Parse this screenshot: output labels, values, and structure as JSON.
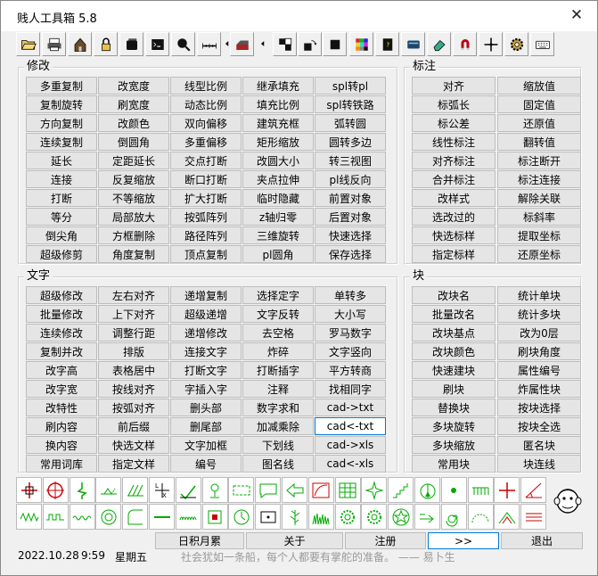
{
  "app": {
    "title": "贱人工具箱 5.8",
    "close_glyph": "✕"
  },
  "toolbar_icons": [
    "open-folder-icon",
    "print-icon",
    "house-icon",
    "lock-icon",
    "stack-icon",
    "terminal-icon",
    "magnifier-icon",
    "measure-icon",
    "arrow-left-icon",
    "wall-icon",
    "arrow-left-icon",
    "blocks-icon",
    "copy-rotate-icon",
    "black-square-icon",
    "color-grid-icon",
    "notebook-icon",
    "card-icon",
    "eraser-icon",
    "magnet-icon",
    "crosshair-icon",
    "gear-icon",
    "keyboard-icon"
  ],
  "groups": {
    "modify": {
      "label": "修改",
      "rows": [
        [
          "多重复制",
          "改宽度",
          "线型比例",
          "继承填充",
          "spl转pl"
        ],
        [
          "复制旋转",
          "刷宽度",
          "动态比例",
          "填充比例",
          "spl转铁路"
        ],
        [
          "方向复制",
          "改颜色",
          "双向偏移",
          "建筑充框",
          "弧转圆"
        ],
        [
          "连续复制",
          "倒圆角",
          "多重偏移",
          "矩形缩放",
          "圆转多边"
        ],
        [
          "延长",
          "定距延长",
          "交点打断",
          "改圆大小",
          "转三视图"
        ],
        [
          "连接",
          "反复缩放",
          "断口打断",
          "夹点拉伸",
          "pl线反向"
        ],
        [
          "打断",
          "不等缩放",
          "扩大打断",
          "临时隐藏",
          "前置对象"
        ],
        [
          "等分",
          "局部放大",
          "按弧阵列",
          "z轴归零",
          "后置对象"
        ],
        [
          "倒尖角",
          "方框删除",
          "路径阵列",
          "三维旋转",
          "快速选择"
        ],
        [
          "超级修剪",
          "角度复制",
          "顶点复制",
          "pl圆角",
          "保存选择"
        ]
      ]
    },
    "annotate": {
      "label": "标注",
      "rows": [
        [
          "对齐",
          "缩放值"
        ],
        [
          "标弧长",
          "固定值"
        ],
        [
          "标公差",
          "还原值"
        ],
        [
          "线性标注",
          "翻转值"
        ],
        [
          "对齐标注",
          "标注断开"
        ],
        [
          "合并标注",
          "标注连接"
        ],
        [
          "改样式",
          "解除关联"
        ],
        [
          "选改过的",
          "标斜率"
        ],
        [
          "快选标样",
          "提取坐标"
        ],
        [
          "指定标样",
          "还原坐标"
        ]
      ]
    },
    "text": {
      "label": "文字",
      "rows": [
        [
          "超级修改",
          "左右对齐",
          "递增复制",
          "选择定字",
          "单转多"
        ],
        [
          "批量修改",
          "上下对齐",
          "超级递增",
          "文字反转",
          "大小写"
        ],
        [
          "连续修改",
          "调整行距",
          "递增修改",
          "去空格",
          "罗马数字"
        ],
        [
          "复制并改",
          "排版",
          "连接文字",
          "炸碎",
          "文字竖向"
        ],
        [
          "改字高",
          "表格居中",
          "打断文字",
          "打断插字",
          "平方转商"
        ],
        [
          "改字宽",
          "按线对齐",
          "字插入字",
          "注释",
          "找相同字"
        ],
        [
          "改特性",
          "按弧对齐",
          "删头部",
          "数字求和",
          "cad->txt"
        ],
        [
          "刷内容",
          "前后缀",
          "删尾部",
          "加减乘除",
          "cad<-txt"
        ],
        [
          "换内容",
          "快选文样",
          "文字加框",
          "下划线",
          "cad->xls"
        ],
        [
          "常用词库",
          "指定文样",
          "编号",
          "图名线",
          "cad<-xls"
        ]
      ]
    },
    "block": {
      "label": "块",
      "rows": [
        [
          "改块名",
          "统计单块"
        ],
        [
          "批量改名",
          "统计多块"
        ],
        [
          "改块基点",
          "改为0层"
        ],
        [
          "改块颜色",
          "刷块角度"
        ],
        [
          "快速建块",
          "属性编号"
        ],
        [
          "刷块",
          "炸属性块"
        ],
        [
          "替换块",
          "按块选择"
        ],
        [
          "多块旋转",
          "按块全选"
        ],
        [
          "多块缩放",
          "匿名块"
        ],
        [
          "常用块",
          "块连线"
        ]
      ]
    }
  },
  "icon_row1": [
    "cross-axis-icon",
    "target-icon",
    "break-line-icon",
    "weld-symbol-icon",
    "hatch-icon",
    "dimension-icon",
    "checkmark-icon",
    "lamp-icon",
    "wavy-rect-icon",
    "speech-bubble-icon",
    "arrow-left-outline-icon",
    "curve-box-icon",
    "table-grid-icon",
    "star-point-icon",
    "stairs-icon",
    "arch-icon",
    "dot-icon",
    "comb-icon",
    "plus-red-icon",
    "angle-icon"
  ],
  "icon_row2": [
    "zigzag-icon",
    "square-wave-icon",
    "small-wave-icon",
    "concentric-circle-icon",
    "corner-arc-icon",
    "line-icon",
    "coil-icon",
    "box-dot-icon",
    "clock-circle-icon",
    "dot-box-icon",
    "tree-icon",
    "grass-icon",
    "gear-outline-icon",
    "gear-outline-icon",
    "star-circle-icon",
    "arrow-line-icon",
    "spiral-icon",
    "semicircle-icon",
    "chevron-arch-icon",
    "triple-line-icon"
  ],
  "bottom_buttons": [
    "日积月累",
    "关于",
    "注册",
    ">>",
    "退出"
  ],
  "status": {
    "date": "2022.10.28",
    "time": "9:59",
    "weekday": "星期五",
    "quote": "社会犹如一条船，每个人都要有掌舵的准备。 —— 易卜生"
  }
}
